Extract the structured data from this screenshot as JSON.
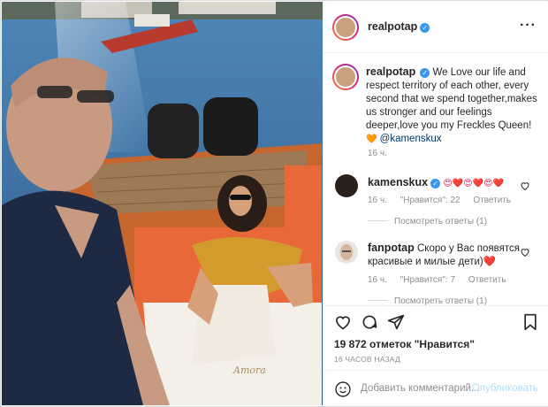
{
  "post": {
    "author": "realpotap",
    "verified": true,
    "more_icon": "more-dots-icon"
  },
  "caption": {
    "username": "realpotap",
    "text": "We Love our life and respect territory of each other, every second that we spend together,makes us stronger and our feelings deeper,love you my Freckles Queen!",
    "heart": "🧡",
    "mention": "@kamenskux",
    "time": "16 ч."
  },
  "comments": [
    {
      "username": "kamenskux",
      "verified": true,
      "text": "😍❤️😍❤️😍❤️",
      "time": "16 ч.",
      "likes_label": "\"Нравится\": 22",
      "reply_label": "Ответить",
      "view_replies": "Посмотреть ответы (1)"
    },
    {
      "username": "fanpotap",
      "verified": false,
      "text": "Скоро у Вас появятся красивые и милые дети)❤️",
      "time": "16 ч.",
      "likes_label": "\"Нравится\": 7",
      "reply_label": "Ответить",
      "view_replies": "Посмотреть ответы (1)"
    }
  ],
  "actions": {
    "like_icon": "heart-icon",
    "comment_icon": "comment-icon",
    "share_icon": "share-icon",
    "save_icon": "bookmark-icon",
    "likes": "19 872 отметок \"Нравится\"",
    "time_ago": "16 ЧАСОВ НАЗАД",
    "add_comment_placeholder": "Добавить комментарий...",
    "publish_label": "Опубликовать",
    "emoji_icon": "smiley-icon"
  },
  "photo": {
    "towel_text": "Amora"
  },
  "colors": {
    "accent": "#3897f0",
    "link": "#00376b",
    "muted": "#8e8e8e",
    "border": "#dbdbdb",
    "publish_disabled": "#b2dffc"
  }
}
